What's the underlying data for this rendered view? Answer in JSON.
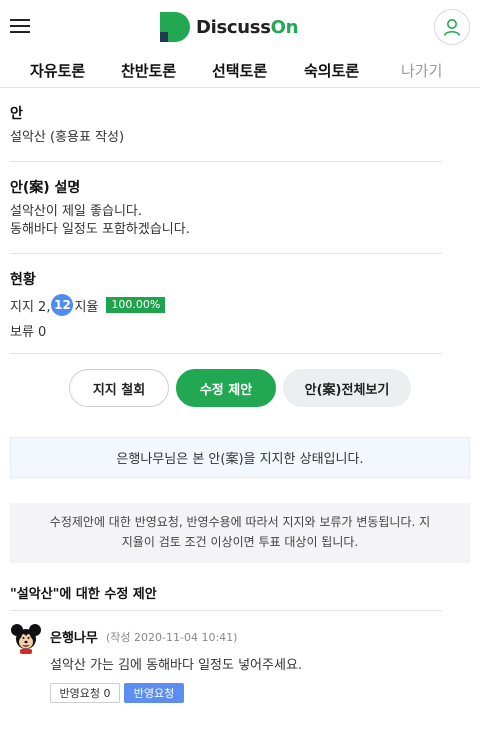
{
  "header": {
    "logo_main": "Discuss",
    "logo_accent": "On"
  },
  "nav": {
    "items": [
      {
        "label": "자유토론"
      },
      {
        "label": "찬반토론"
      },
      {
        "label": "선택토론"
      },
      {
        "label": "숙의토론"
      },
      {
        "label": "나가기"
      }
    ]
  },
  "proposal": {
    "section_label": "안",
    "title_text": "설악산 (홍용표 작성)"
  },
  "description": {
    "section_label": "안(案) 설명",
    "lines": [
      "설악산이 제일 좋습니다.",
      "동해바다 일정도 포함하겠습니다."
    ]
  },
  "status": {
    "section_label": "현황",
    "support_prefix": "지지 2,",
    "notification_count": "12",
    "support_suffix": "지율",
    "percent": "100.00%",
    "hold_text": "보류 0"
  },
  "actions": {
    "withdraw_label": "지지 철회",
    "suggest_label": "수정 제안",
    "view_all_label": "안(案)전체보기"
  },
  "notice": {
    "support_status": "은행나무님은 본 안(案)을 지지한 상태입니다.",
    "info_lines": [
      "수정제안에 대한 반영요청, 반영수용에 따라서 지지와 보류가 변동됩니다. 지",
      "지율이 검토 조건 이상이면 투표 대상이 됩니다."
    ]
  },
  "suggestions": {
    "heading": "\"설악산\"에 대한 수정 제안",
    "items": [
      {
        "author": "은행나무",
        "meta": "(작성 2020-11-04 10:41)",
        "body": "설악산 가는 김에 동해바다 일정도 넣어주세요.",
        "request_label": "반영요청 0",
        "accept_label": "반영요청"
      }
    ]
  },
  "colors": {
    "brand_green": "#22a853",
    "badge_blue": "#4d8df2",
    "accept_blue": "#5b8ef0"
  },
  "icons": {
    "menu": "hamburger-menu-icon",
    "user": "user-icon",
    "avatar": "mickey-avatar"
  }
}
